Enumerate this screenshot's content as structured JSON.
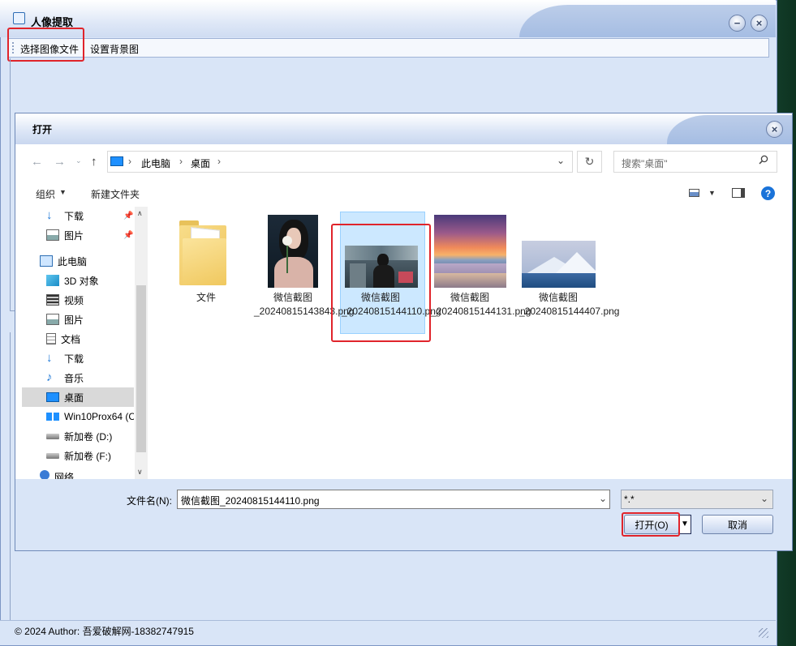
{
  "main": {
    "title": "人像提取",
    "menu": [
      "选择图像文件",
      "设置背景图"
    ],
    "status": "© 2024 Author: 吾爱破解网-18382747915"
  },
  "dialog": {
    "title": "打开",
    "address": [
      "此电脑",
      "桌面"
    ],
    "search_placeholder": "搜索\"桌面\"",
    "toolbar": {
      "organize": "组织",
      "new_folder": "新建文件夹"
    },
    "nav_items": [
      {
        "label": "下载",
        "icon": "download-icon"
      },
      {
        "label": "图片",
        "icon": "pictures-icon"
      },
      {
        "label": "此电脑",
        "icon": "computer-icon"
      },
      {
        "label": "3D 对象",
        "icon": "3d-objects-icon"
      },
      {
        "label": "视频",
        "icon": "video-icon"
      },
      {
        "label": "图片",
        "icon": "pictures-icon"
      },
      {
        "label": "文档",
        "icon": "documents-icon"
      },
      {
        "label": "下载",
        "icon": "download-icon"
      },
      {
        "label": "音乐",
        "icon": "music-icon"
      },
      {
        "label": "桌面",
        "icon": "desktop-icon"
      },
      {
        "label": "Win10Prox64 (C",
        "icon": "windows-drive-icon"
      },
      {
        "label": "新加卷 (D:)",
        "icon": "drive-icon"
      },
      {
        "label": "新加卷 (F:)",
        "icon": "drive-icon"
      },
      {
        "label": "网络",
        "icon": "network-icon"
      }
    ],
    "files": [
      {
        "name": "文件",
        "type": "folder"
      },
      {
        "name": "微信截图\n_20240815143843.png",
        "type": "image"
      },
      {
        "name": "微信截图\n_20240815144110.png",
        "type": "image",
        "selected": true
      },
      {
        "name": "微信截图\n_20240815144131.png",
        "type": "image"
      },
      {
        "name": "微信截图\n_20240815144407.png",
        "type": "image"
      }
    ],
    "filename_label": "文件名(N):",
    "filename_value": "微信截图_20240815144110.png",
    "filetype_value": "*.*",
    "open_button": "打开(O)",
    "cancel_button": "取消"
  },
  "colors": {
    "highlight": "#e0242b",
    "selection": "#cce8ff",
    "window_bg": "#d9e5f7"
  }
}
